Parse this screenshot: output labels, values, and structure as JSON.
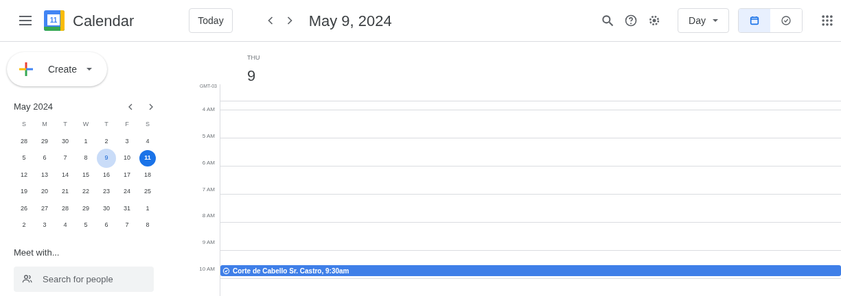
{
  "header": {
    "app_name": "Calendar",
    "logo_day": "11",
    "today_button": "Today",
    "date_title": "May 9, 2024",
    "view_select": "Day",
    "view_toggle": [
      {
        "kind": "calendar",
        "selected": true
      },
      {
        "kind": "tasks",
        "selected": false
      }
    ]
  },
  "sidebar": {
    "create_button": "Create",
    "mini_calendar": {
      "title": "May 2024",
      "weekdays": [
        "S",
        "M",
        "T",
        "W",
        "T",
        "F",
        "S"
      ],
      "weeks": [
        [
          {
            "d": "28",
            "selected": false,
            "today": false
          },
          {
            "d": "29",
            "selected": false,
            "today": false
          },
          {
            "d": "30",
            "selected": false,
            "today": false
          },
          {
            "d": "1",
            "selected": false,
            "today": false
          },
          {
            "d": "2",
            "selected": false,
            "today": false
          },
          {
            "d": "3",
            "selected": false,
            "today": false
          },
          {
            "d": "4",
            "selected": false,
            "today": false
          }
        ],
        [
          {
            "d": "5",
            "selected": false,
            "today": false
          },
          {
            "d": "6",
            "selected": false,
            "today": false
          },
          {
            "d": "7",
            "selected": false,
            "today": false
          },
          {
            "d": "8",
            "selected": false,
            "today": false
          },
          {
            "d": "9",
            "selected": true,
            "today": false
          },
          {
            "d": "10",
            "selected": false,
            "today": false
          },
          {
            "d": "11",
            "selected": false,
            "today": true
          }
        ],
        [
          {
            "d": "12",
            "selected": false,
            "today": false
          },
          {
            "d": "13",
            "selected": false,
            "today": false
          },
          {
            "d": "14",
            "selected": false,
            "today": false
          },
          {
            "d": "15",
            "selected": false,
            "today": false
          },
          {
            "d": "16",
            "selected": false,
            "today": false
          },
          {
            "d": "17",
            "selected": false,
            "today": false
          },
          {
            "d": "18",
            "selected": false,
            "today": false
          }
        ],
        [
          {
            "d": "19",
            "selected": false,
            "today": false
          },
          {
            "d": "20",
            "selected": false,
            "today": false
          },
          {
            "d": "21",
            "selected": false,
            "today": false
          },
          {
            "d": "22",
            "selected": false,
            "today": false
          },
          {
            "d": "23",
            "selected": false,
            "today": false
          },
          {
            "d": "24",
            "selected": false,
            "today": false
          },
          {
            "d": "25",
            "selected": false,
            "today": false
          }
        ],
        [
          {
            "d": "26",
            "selected": false,
            "today": false
          },
          {
            "d": "27",
            "selected": false,
            "today": false
          },
          {
            "d": "28",
            "selected": false,
            "today": false
          },
          {
            "d": "29",
            "selected": false,
            "today": false
          },
          {
            "d": "30",
            "selected": false,
            "today": false
          },
          {
            "d": "31",
            "selected": false,
            "today": false
          },
          {
            "d": "1",
            "selected": false,
            "today": false
          }
        ],
        [
          {
            "d": "2",
            "selected": false,
            "today": false
          },
          {
            "d": "3",
            "selected": false,
            "today": false
          },
          {
            "d": "4",
            "selected": false,
            "today": false
          },
          {
            "d": "5",
            "selected": false,
            "today": false
          },
          {
            "d": "6",
            "selected": false,
            "today": false
          },
          {
            "d": "7",
            "selected": false,
            "today": false
          },
          {
            "d": "8",
            "selected": false,
            "today": false
          }
        ]
      ]
    },
    "meet_with": "Meet with...",
    "search_people": {
      "placeholder": "Search for people"
    }
  },
  "day_view": {
    "weekday": "THU",
    "day": "9",
    "timezone": "GMT-03",
    "hours": [
      "4 AM",
      "5 AM",
      "6 AM",
      "7 AM",
      "8 AM",
      "9 AM",
      "10 AM"
    ],
    "events": [
      {
        "title": "Corte de Cabello Sr. Castro, 9:30am",
        "color": "#3f7fe8"
      }
    ]
  }
}
